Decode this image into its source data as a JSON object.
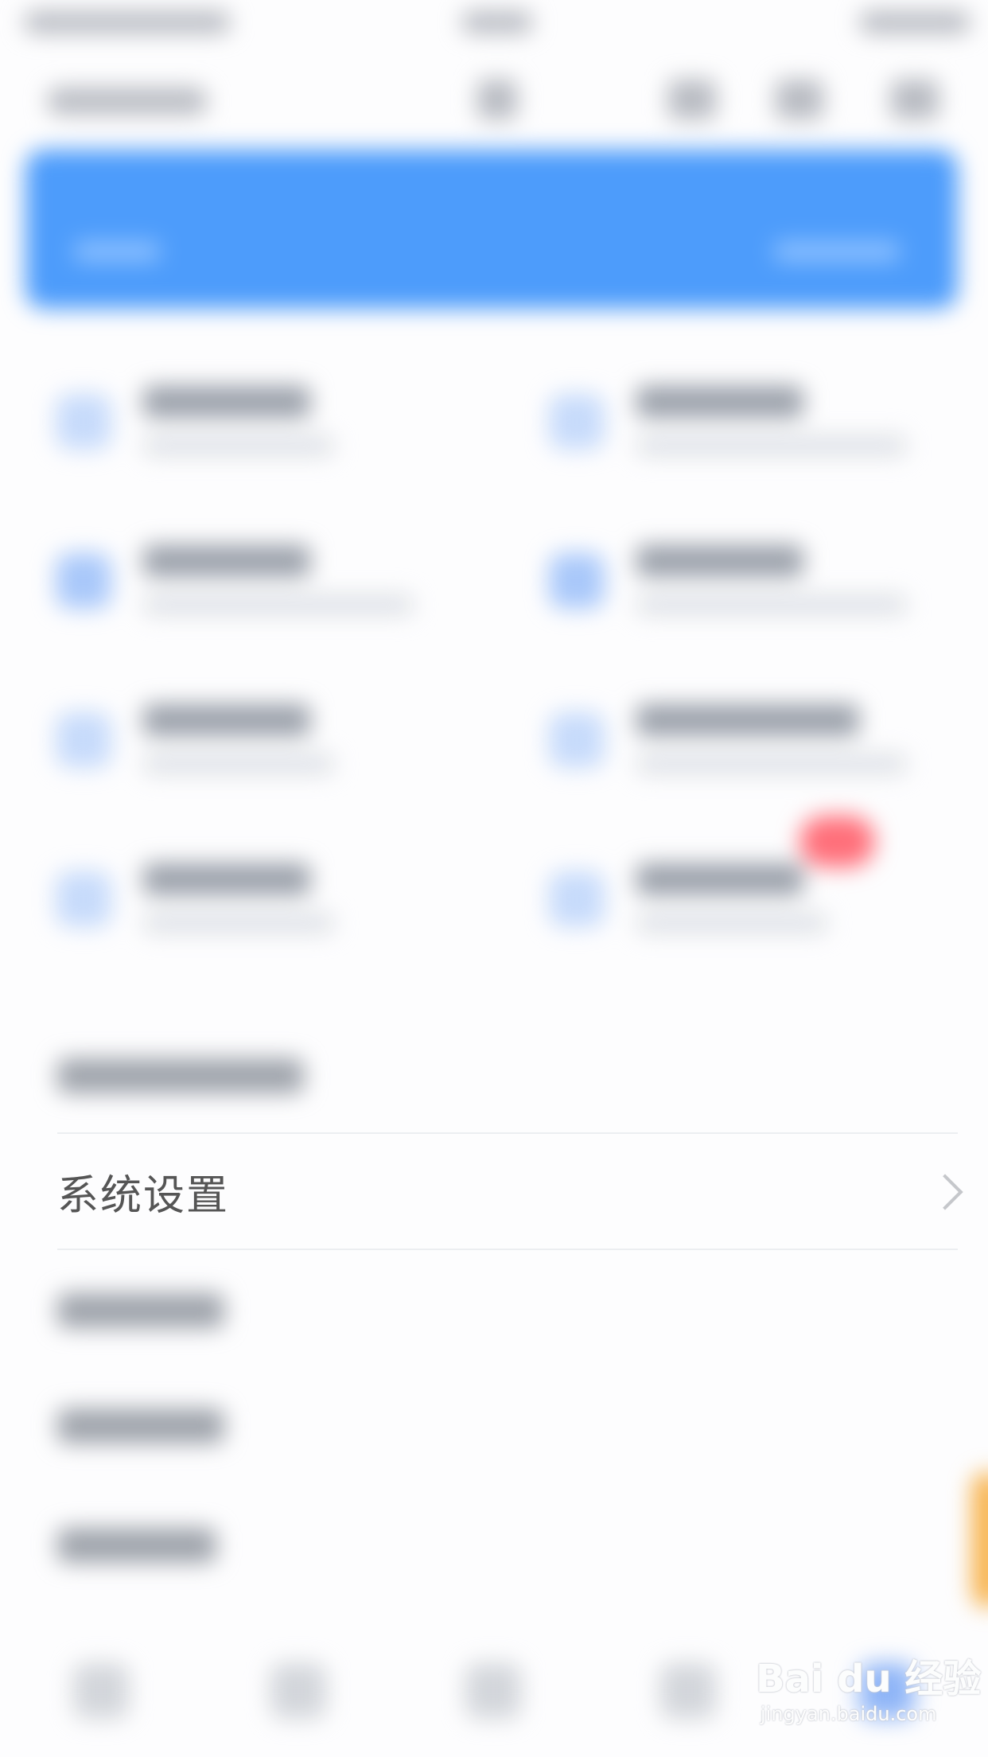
{
  "settings_row": {
    "label": "系统设置",
    "chevron_icon": "chevron-right-icon"
  },
  "watermark": {
    "logo_text": "Bai du 经验",
    "url_text": "jingyan.baidu.com"
  },
  "colors": {
    "banner": "#4d9cfb",
    "badge": "#ff6f7a",
    "label": "#555555",
    "divider": "#eceef1"
  }
}
